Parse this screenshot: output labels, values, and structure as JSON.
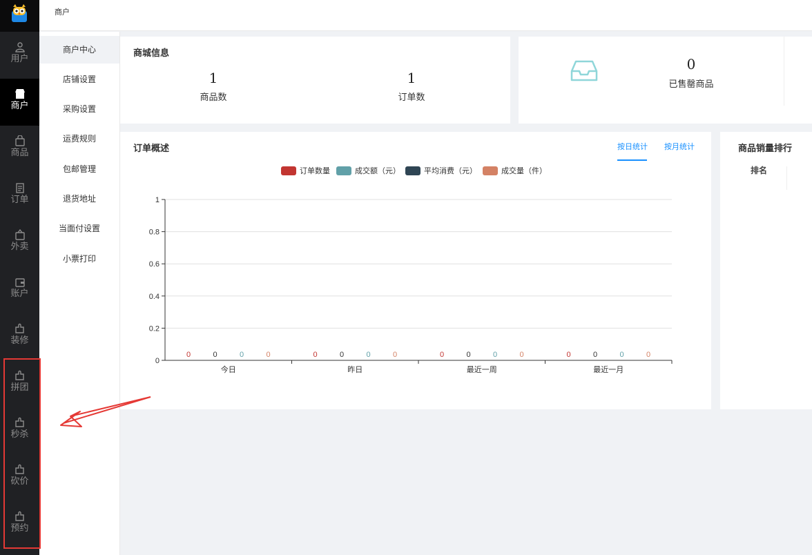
{
  "topbar": {
    "breadcrumb": "商户"
  },
  "nav": {
    "items": [
      {
        "label": "用户",
        "icon": "user-icon"
      },
      {
        "label": "商户",
        "icon": "shop-icon"
      },
      {
        "label": "商品",
        "icon": "bag-icon"
      },
      {
        "label": "订单",
        "icon": "clipboard-icon"
      },
      {
        "label": "外卖",
        "icon": "box-icon"
      },
      {
        "label": "账户",
        "icon": "wallet-icon"
      },
      {
        "label": "装修",
        "icon": "puzzle-icon"
      },
      {
        "label": "拼团",
        "icon": "puzzle-icon"
      },
      {
        "label": "秒杀",
        "icon": "puzzle-icon"
      },
      {
        "label": "砍价",
        "icon": "puzzle-icon"
      },
      {
        "label": "预约",
        "icon": "puzzle-icon"
      }
    ],
    "active_index": 1
  },
  "submenu": {
    "items": [
      "商户中心",
      "店铺设置",
      "采购设置",
      "运费规则",
      "包邮管理",
      "退货地址",
      "当面付设置",
      "小票打印"
    ],
    "active_index": 0
  },
  "mall_info": {
    "title": "商城信息",
    "products_count": "1",
    "products_label": "商品数",
    "orders_count": "1",
    "orders_label": "订单数"
  },
  "sold_out": {
    "value": "0",
    "label": "已售罄商品",
    "icon": "inbox-icon"
  },
  "order_overview": {
    "title": "订单概述",
    "tab_day": "按日统计",
    "tab_month": "按月统计",
    "active_tab": "按日统计"
  },
  "ranking": {
    "title": "商品销量排行",
    "column_rank": "排名"
  },
  "colors": {
    "accent": "#1890ff",
    "nav_bg": "#202124",
    "annotation": "#e53935"
  },
  "chart_data": {
    "type": "bar",
    "categories": [
      "今日",
      "昨日",
      "最近一周",
      "最近一月"
    ],
    "series": [
      {
        "name": "订单数量",
        "color": "#c23531",
        "values": [
          0,
          0,
          0,
          0
        ]
      },
      {
        "name": "成交额（元）",
        "color": "#61a0a8",
        "values": [
          0,
          0,
          0,
          0
        ]
      },
      {
        "name": "平均消费（元）",
        "color": "#2f4554",
        "values": [
          0,
          0,
          0,
          0
        ]
      },
      {
        "name": "成交量（件）",
        "color": "#d48265",
        "values": [
          0,
          0,
          0,
          0
        ]
      }
    ],
    "value_label_colors": [
      "#c23531",
      "#333333",
      "#61a0a8",
      "#d48265"
    ],
    "yticks": [
      "0",
      "0.2",
      "0.4",
      "0.6",
      "0.8",
      "1"
    ],
    "ylim": [
      0,
      1
    ],
    "grid": true,
    "legend": "top-center"
  }
}
